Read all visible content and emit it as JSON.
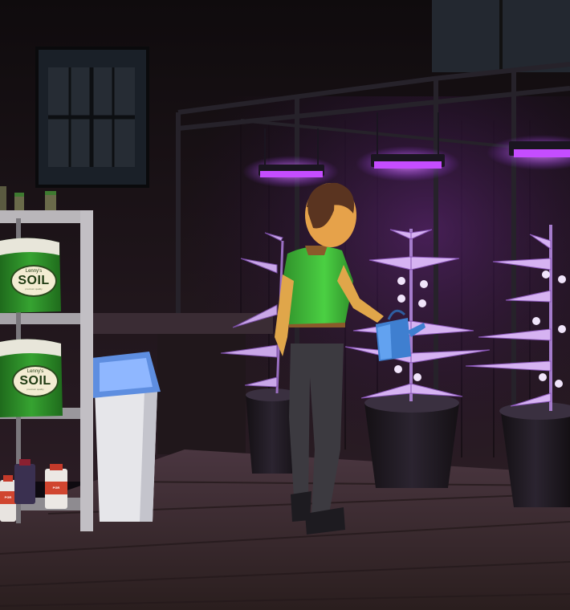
{
  "scene": {
    "colors": {
      "grow_light": "#b44cff",
      "light_glow": "#d46bff",
      "shirt": "#3fb83a",
      "soil_bag": "#2f8f2a",
      "bag_label_bg": "#f3ecd2",
      "wall": "#1e1517",
      "floor": "#3b2c30"
    },
    "soil_bags": [
      {
        "brand": "Lenny's",
        "product": "SOIL",
        "tagline": "premium quality"
      },
      {
        "brand": "Lenny's",
        "product": "SOIL",
        "tagline": "premium quality"
      }
    ],
    "bottles": [
      {
        "label": "PGR"
      },
      {
        "label": "PGR"
      }
    ],
    "icons": [
      "window",
      "shelf",
      "trash-bin",
      "grow-light",
      "plant-pot",
      "watering-can",
      "character"
    ]
  }
}
